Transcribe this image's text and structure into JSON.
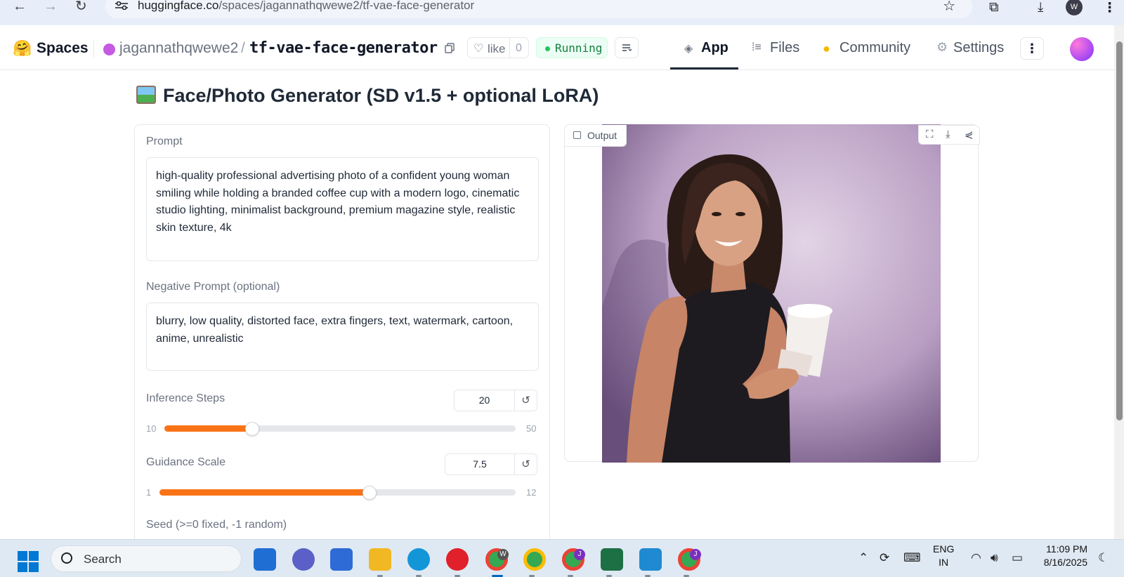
{
  "browser": {
    "url_host": "huggingface.co",
    "url_path": "/spaces/jagannathqwewe2/tf-vae-face-generator",
    "profile_initial": "W"
  },
  "header": {
    "spaces_label": "Spaces",
    "owner": "jagannathqwewe2",
    "separator": "/",
    "repo": "tf-vae-face-generator",
    "like_label": "like",
    "like_count": "0",
    "status": "Running",
    "tabs": [
      {
        "label": "App",
        "icon": "cube-icon",
        "active": true
      },
      {
        "label": "Files",
        "icon": "files-icon",
        "active": false
      },
      {
        "label": "Community",
        "icon": "community-icon",
        "active": false
      },
      {
        "label": "Settings",
        "icon": "gear-icon",
        "active": false
      }
    ],
    "accent": "#f97316",
    "status_color": "#22c55e"
  },
  "app": {
    "title": "Face/Photo Generator (SD v1.5 + optional LoRA)",
    "prompt_label": "Prompt",
    "prompt_value": "high-quality professional advertising photo of a confident young woman smiling while holding a branded coffee cup with a modern logo, cinematic studio lighting, minimalist background, premium magazine style, realistic skin texture, 4k",
    "negative_label": "Negative Prompt (optional)",
    "negative_value": "blurry, low quality, distorted face, extra fingers, text, watermark, cartoon, anime, unrealistic",
    "steps": {
      "label": "Inference Steps",
      "value": "20",
      "min": "10",
      "max": "50",
      "fraction": 0.25
    },
    "guidance": {
      "label": "Guidance Scale",
      "value": "7.5",
      "min": "1",
      "max": "12",
      "fraction": 0.59
    },
    "seed_label": "Seed (>=0 fixed, -1 random)",
    "output_label": "Output"
  },
  "taskbar": {
    "search_placeholder": "Search",
    "lang_line1": "ENG",
    "lang_line2": "IN",
    "time": "11:09 PM",
    "date": "8/16/2025"
  }
}
